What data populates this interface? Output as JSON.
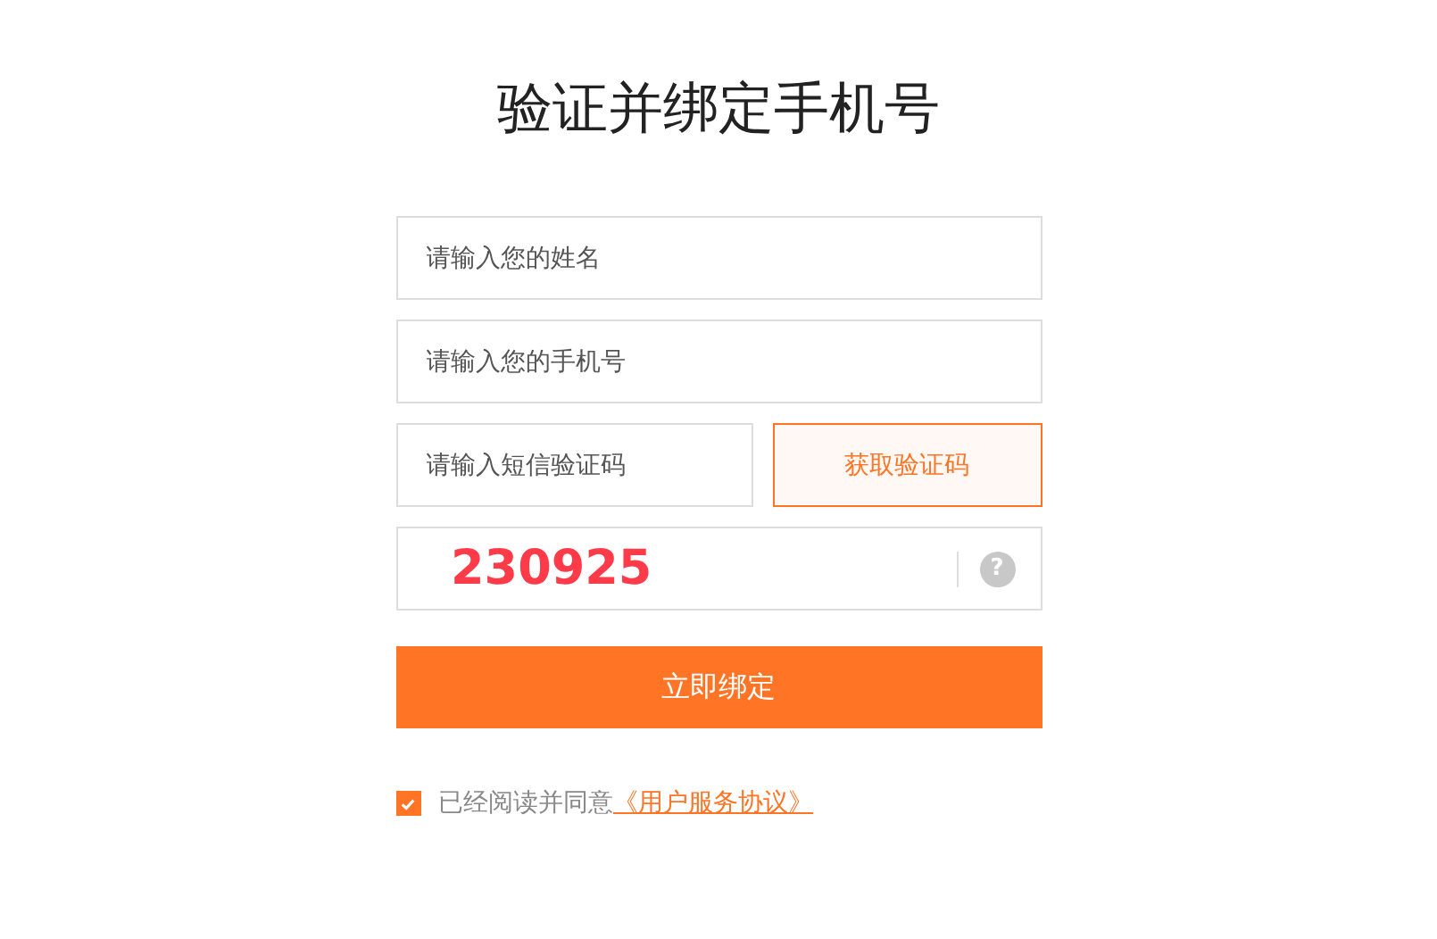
{
  "title": "验证并绑定手机号",
  "fields": [
    {
      "placeholder": "请输入您的姓名"
    },
    {
      "placeholder": "请输入您的手机号"
    }
  ],
  "sms": {
    "placeholder": "请输入短信验证码",
    "button": "获取验证码"
  },
  "captcha": {
    "code": "230925",
    "help": "?"
  },
  "submit": "立即绑定",
  "agreement": {
    "checked": true,
    "text": "已经阅读并同意",
    "link": "《用户服务协议》"
  }
}
